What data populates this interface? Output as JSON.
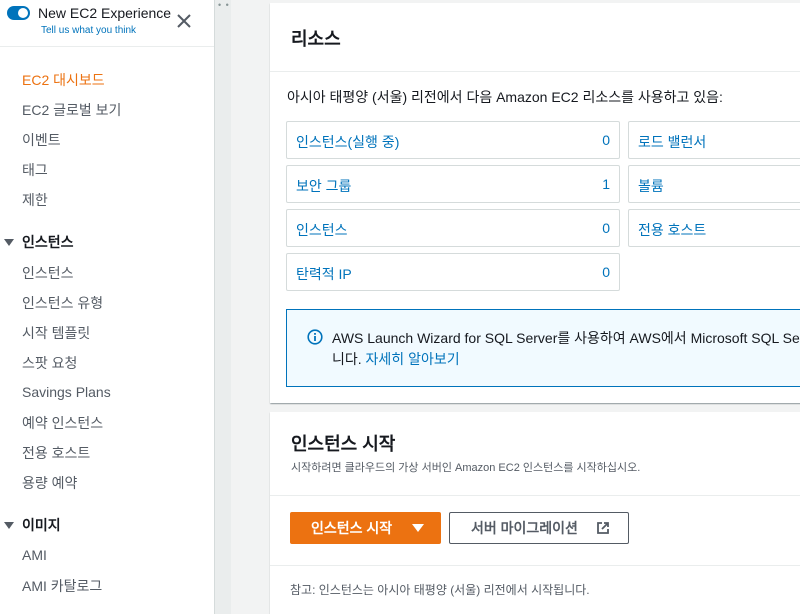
{
  "sidebar": {
    "experience_title": "New EC2 Experience",
    "experience_link": "Tell us what you think",
    "items_top": [
      {
        "label": "EC2 대시보드",
        "active": true
      },
      {
        "label": "EC2 글로벌 보기",
        "active": false
      },
      {
        "label": "이벤트",
        "active": false
      },
      {
        "label": "태그",
        "active": false
      },
      {
        "label": "제한",
        "active": false
      }
    ],
    "section_instances": "인스턴스",
    "items_instances": [
      "인스턴스",
      "인스턴스 유형",
      "시작 템플릿",
      "스팟 요청",
      "Savings Plans",
      "예약 인스턴스",
      "전용 호스트",
      "용량 예약"
    ],
    "section_images": "이미지",
    "items_images": [
      "AMI",
      "AMI 카탈로그"
    ]
  },
  "resources": {
    "title": "리소스",
    "intro": "아시아 태평양 (서울) 리전에서 다음 Amazon EC2 리소스를 사용하고 있음:",
    "cards_left": [
      {
        "label": "인스턴스(실행 중)",
        "count": "0"
      },
      {
        "label": "보안 그룹",
        "count": "1"
      },
      {
        "label": "인스턴스",
        "count": "0"
      },
      {
        "label": "탄력적 IP",
        "count": "0"
      }
    ],
    "cards_right": [
      {
        "label": "로드 밸런서"
      },
      {
        "label": "볼륨"
      },
      {
        "label": "전용 호스트"
      }
    ],
    "info_line1": "AWS Launch Wizard for SQL Server를 사용하여 AWS에서 Microsoft SQL Server",
    "info_line2_prefix": "니다. ",
    "info_link": "자세히 알아보기"
  },
  "launch": {
    "title": "인스턴스 시작",
    "subtitle": "시작하려면 클라우드의 가상 서버인 Amazon EC2 인스턴스를 시작하십시오.",
    "launch_button": "인스턴스 시작",
    "migrate_button": "서버 마이그레이션",
    "note": "참고: 인스턴스는 아시아 태평양 (서울) 리전에서 시작됩니다."
  },
  "colors": {
    "accent": "#ec7211",
    "link": "#0073bb",
    "info_bg": "#f1faff"
  }
}
